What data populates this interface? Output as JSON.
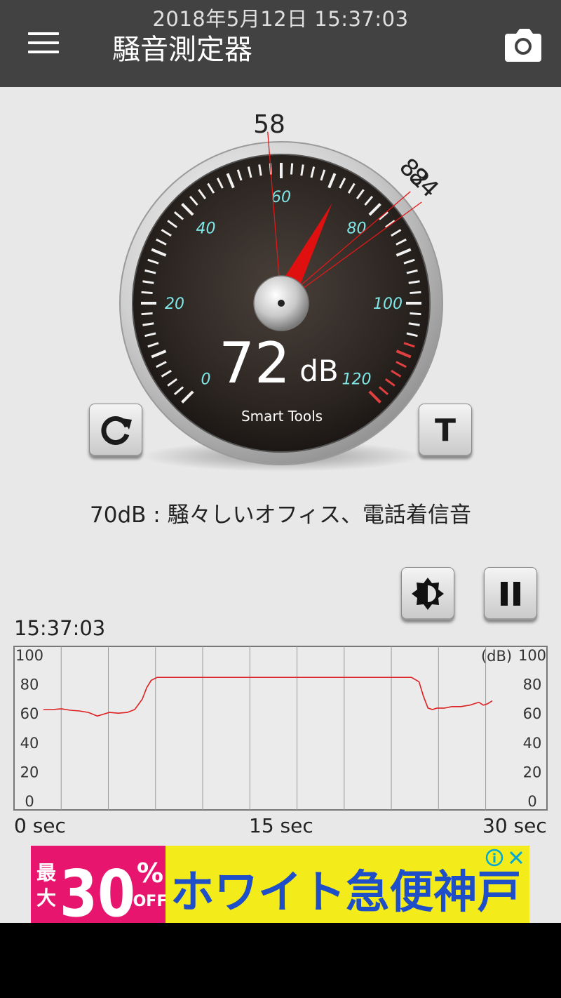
{
  "status_bar": {
    "datetime": "2018年5月12日 15:37:03"
  },
  "app_bar": {
    "title": "騒音測定器",
    "menu_icon": "hamburger-menu-icon",
    "camera_icon": "camera-icon"
  },
  "gauge": {
    "min_marker": "58",
    "max_marker_a": "82",
    "max_marker_b": "84",
    "scale_labels": [
      "0",
      "20",
      "40",
      "60",
      "80",
      "100",
      "120"
    ],
    "value": "72",
    "unit": "dB",
    "brand": "Smart Tools",
    "needle_value": 72,
    "min_value": 58,
    "max_value_a": 82,
    "max_value_b": 84
  },
  "buttons": {
    "reset_icon": "refresh-icon",
    "t_label": "T",
    "brightness_icon": "brightness-icon",
    "pause_icon": "pause-icon"
  },
  "description": "70dB : 騒々しいオフィス、電話着信音",
  "chart_header_time": "15:37:03",
  "chart_data": {
    "type": "line",
    "unit_label": "(dB)",
    "y_ticks": [
      "100",
      "80",
      "60",
      "40",
      "20",
      "0"
    ],
    "ylim": [
      0,
      100
    ],
    "xlim": [
      0,
      30
    ],
    "x_labels": [
      "0 sec",
      "15 sec",
      "30 sec"
    ],
    "grid": true,
    "series": [
      {
        "color": "#dd2020",
        "x": [
          0,
          0.6,
          1.2,
          1.8,
          2.4,
          3.0,
          3.6,
          4.4,
          5.0,
          5.6,
          6.1,
          6.6,
          6.9,
          7.2,
          7.6,
          8.2,
          10,
          15,
          20,
          24.6,
          25.1,
          25.4,
          25.7,
          26.0,
          26.3,
          26.8,
          27.3,
          27.9,
          28.5,
          29.1,
          29.4,
          29.7,
          30.0
        ],
        "y": [
          63,
          63,
          63.5,
          62.5,
          62,
          61,
          58.5,
          61,
          60.5,
          61,
          63,
          70,
          78,
          83,
          85,
          85,
          85,
          85,
          85,
          85,
          82,
          72,
          64,
          63,
          64,
          64,
          65,
          65,
          66,
          68,
          66,
          67,
          69
        ]
      }
    ]
  },
  "ad": {
    "left_small_top": "最",
    "left_small_bottom": "大",
    "percent_number": "30",
    "percent_sign": "%",
    "off": "OFF",
    "main_text": "ホワイト急便神戸",
    "info_icon": "info-icon",
    "close_icon": "close-icon"
  },
  "colors": {
    "app_bar": "#424242",
    "background": "#e8e8e8",
    "needle": "#e01010",
    "gauge_labels": "#7fe7e7",
    "chart_line": "#dd2020",
    "ad_pink": "#e8156e",
    "ad_yellow": "#f4ec1a",
    "ad_blue": "#1f4fc8"
  }
}
